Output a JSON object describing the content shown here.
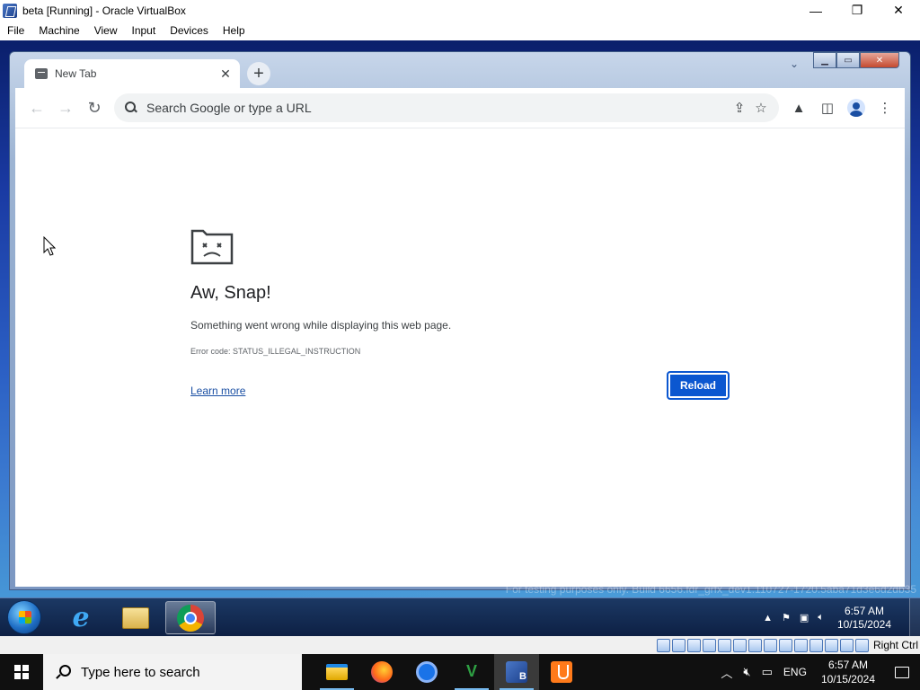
{
  "host_window": {
    "title": "beta [Running] - Oracle VirtualBox",
    "minimize_glyph": "—",
    "restore_glyph": "❐",
    "close_glyph": "✕"
  },
  "host_menu": [
    "File",
    "Machine",
    "View",
    "Input",
    "Devices",
    "Help"
  ],
  "chrome": {
    "tab_title": "New Tab",
    "tab_close_glyph": "✕",
    "new_tab_glyph": "+",
    "back_glyph": "←",
    "forward_glyph": "→",
    "reload_glyph": "↻",
    "omnibox_placeholder": "Search Google or type a URL",
    "share_glyph": "⇪",
    "bookmark_glyph": "☆",
    "labs_glyph": "▲",
    "sidepanel_glyph": "◫",
    "menu_glyph": "⋮"
  },
  "sad_tab": {
    "title": "Aw, Snap!",
    "message": "Something went wrong while displaying this web page.",
    "error_code": "Error code: STATUS_ILLEGAL_INSTRUCTION",
    "learn_more": "Learn more",
    "reload": "Reload"
  },
  "watermark": "For testing purposes only. Build 6656.fdr_grfx_dev1.110727-1720.5aba71d3e6d2db35",
  "guest_taskbar": {
    "tray_arrow": "▲",
    "time": "6:57 AM",
    "date": "10/15/2024"
  },
  "vbox_status": {
    "host_key": "Right Ctrl"
  },
  "host_taskbar": {
    "search_placeholder": "Type here to search",
    "lang": "ENG",
    "time": "6:57 AM",
    "date": "10/15/2024"
  }
}
